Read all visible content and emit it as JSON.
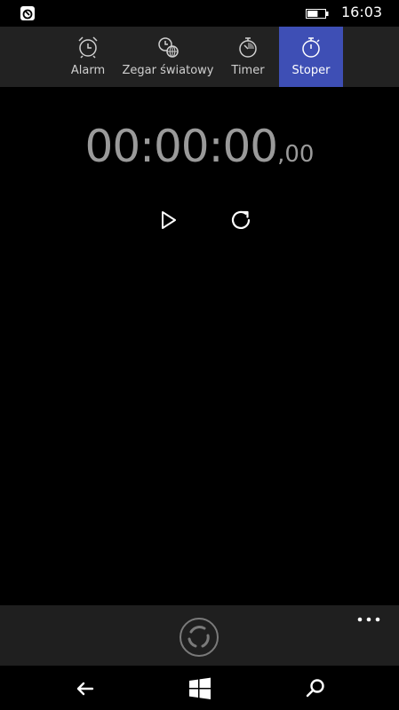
{
  "status": {
    "time": "16:03",
    "battery_level": 0.6
  },
  "tabs": [
    {
      "label": "Alarm",
      "icon": "alarm-clock-icon",
      "active": false
    },
    {
      "label": "Zegar światowy",
      "icon": "world-clock-icon",
      "active": false
    },
    {
      "label": "Timer",
      "icon": "timer-icon",
      "active": false
    },
    {
      "label": "Stoper",
      "icon": "stopwatch-icon",
      "active": true
    }
  ],
  "stopwatch": {
    "time_main": "00:00:00",
    "time_fraction": ",00"
  },
  "controls": {
    "play_icon": "play-icon",
    "reset_icon": "reset-icon"
  },
  "appbar": {
    "sync_icon": "sync-icon",
    "more_icon": "more-icon"
  },
  "navbar": {
    "back_icon": "back-arrow-icon",
    "start_icon": "windows-logo-icon",
    "search_icon": "search-icon"
  },
  "colors": {
    "accent": "#3e4fb5",
    "tabbar_bg": "#222222",
    "appbar_bg": "#1f1f1f",
    "time_text": "#9a9a9a"
  }
}
